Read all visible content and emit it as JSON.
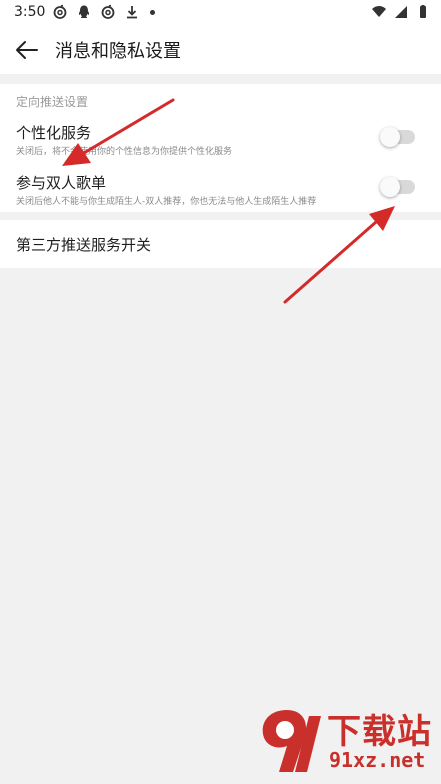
{
  "status_bar": {
    "time": "3:50",
    "left_icons": [
      "netease-music-icon",
      "qq-icon",
      "netease-music-icon",
      "download-icon",
      "dot-icon"
    ],
    "right_icons": [
      "wifi-icon",
      "signal-icon",
      "battery-icon"
    ]
  },
  "header": {
    "title": "消息和隐私设置",
    "back_icon": "arrow-left-icon"
  },
  "section": {
    "title": "定向推送设置",
    "items": [
      {
        "title": "个性化服务",
        "description": "关闭后，将不会使用你的个性信息为你提供个性化服务",
        "toggle_on": false
      },
      {
        "title": "参与双人歌单",
        "description": "关闭后他人不能与你生成陌生人-双人推荐，你也无法与他人生成陌生人推荐",
        "toggle_on": false
      }
    ]
  },
  "third_party": {
    "label": "第三方推送服务开关"
  },
  "watermark": {
    "top": "下载站",
    "bottom": "91xz.net"
  },
  "colors": {
    "background": "#f1f1f1",
    "card": "#ffffff",
    "annotation_arrow": "#d42a2a",
    "toggle_off_track": "#d9d9d9"
  }
}
